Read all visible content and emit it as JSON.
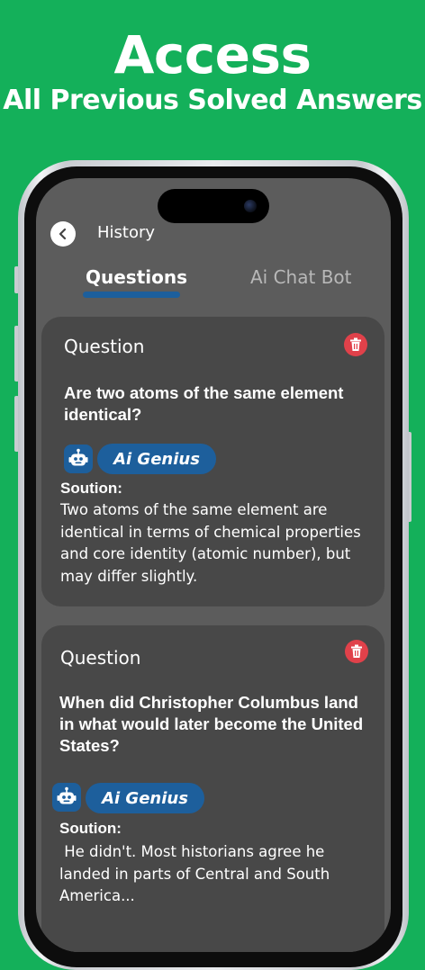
{
  "promo": {
    "title": "Access",
    "subtitle": "All Previous Solved Answers"
  },
  "header": {
    "title": "History"
  },
  "tabs": [
    {
      "label": "Questions",
      "active": true
    },
    {
      "label": "Ai Chat Bot",
      "active": false
    }
  ],
  "cards": [
    {
      "label": "Question",
      "question": "Are two atoms of the same element identical?",
      "bot_name": "Ai Genius",
      "solution_label": "Soution:",
      "solution": "Two atoms of the same element are identical in terms of chemical properties and core identity (atomic number), but may differ slightly."
    },
    {
      "label": "Question",
      "question": "When did Christopher Columbus land in what would later become the United States?",
      "bot_name": "Ai Genius",
      "solution_label": "Soution:",
      "solution": " He didn't. Most historians agree he landed in parts of Central and South America..."
    }
  ],
  "colors": {
    "background": "#14b05a",
    "screen": "#5c5c5c",
    "card": "#484848",
    "accent": "#1d5f9c",
    "delete": "#e0414a"
  },
  "icons": {
    "back": "chevron-left-icon",
    "delete": "trash-icon",
    "bot": "robot-icon"
  }
}
